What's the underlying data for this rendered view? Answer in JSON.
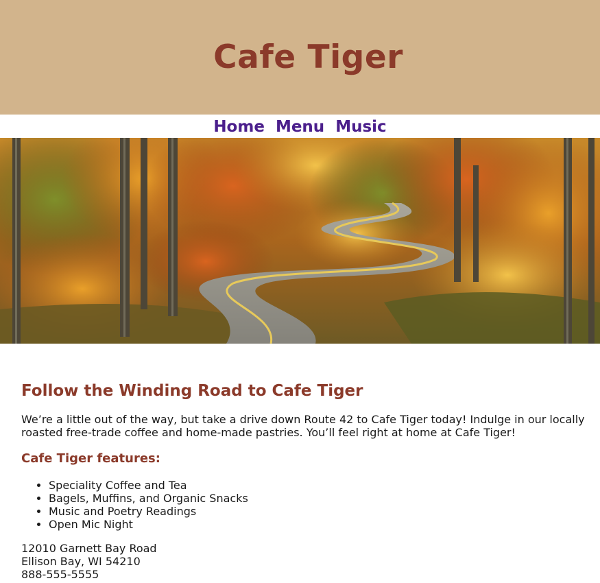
{
  "header": {
    "title": "Cafe Tiger"
  },
  "nav": {
    "items": [
      {
        "label": "Home"
      },
      {
        "label": "Menu"
      },
      {
        "label": "Music"
      }
    ]
  },
  "hero": {
    "image": "winding-road-autumn-forest-photo"
  },
  "main": {
    "heading": "Follow the Winding Road to Cafe Tiger",
    "intro": "We’re a little out of the way, but take a drive down Route 42 to Cafe Tiger today! Indulge in our locally roasted free-trade coffee and home-made pastries. You’ll feel right at home at Cafe Tiger!",
    "features_heading": "Cafe Tiger features:",
    "features": [
      "Speciality Coffee and Tea",
      "Bagels, Muffins, and Organic Snacks",
      "Music and Poetry Readings",
      "Open Mic Night"
    ]
  },
  "address": {
    "street": "12010 Garnett Bay Road",
    "city": "Ellison Bay, WI 54210",
    "phone": "888-555-5555"
  },
  "colors": {
    "header_bg": "#d2b48c",
    "title": "#8b3a2a",
    "nav": "#4b1f8c"
  }
}
